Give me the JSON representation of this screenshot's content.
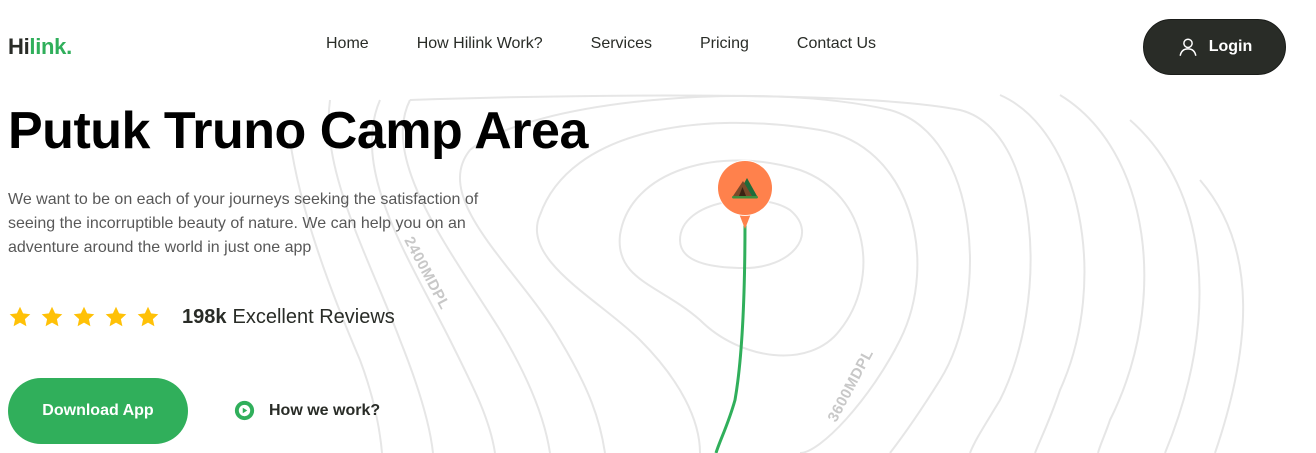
{
  "brand": {
    "name_dark": "Hi",
    "name_green": "link."
  },
  "nav": {
    "items": [
      "Home",
      "How Hilink Work?",
      "Services",
      "Pricing",
      "Contact Us"
    ]
  },
  "login": {
    "label": "Login",
    "icon": "user-icon"
  },
  "hero": {
    "title": "Putuk Truno Camp Area",
    "description": "We want to be on each of your journeys seeking the satisfaction of seeing the incorruptible beauty of nature. We can help you on an adventure around the world in just one app"
  },
  "rating": {
    "stars": 5,
    "count": "198k",
    "label": "Excellent Reviews",
    "star_color": "#FFC107"
  },
  "actions": {
    "download_label": "Download App",
    "how_label": "How we work?"
  },
  "map": {
    "contour_label_1": "2400MDPL",
    "contour_label_2": "3600MDPL",
    "pin_icon": "camp-tent-icon",
    "pin_color": "#FF814C",
    "trail_color": "#30AF5B"
  },
  "colors": {
    "green": "#30AF5B",
    "dark": "#292C27"
  }
}
